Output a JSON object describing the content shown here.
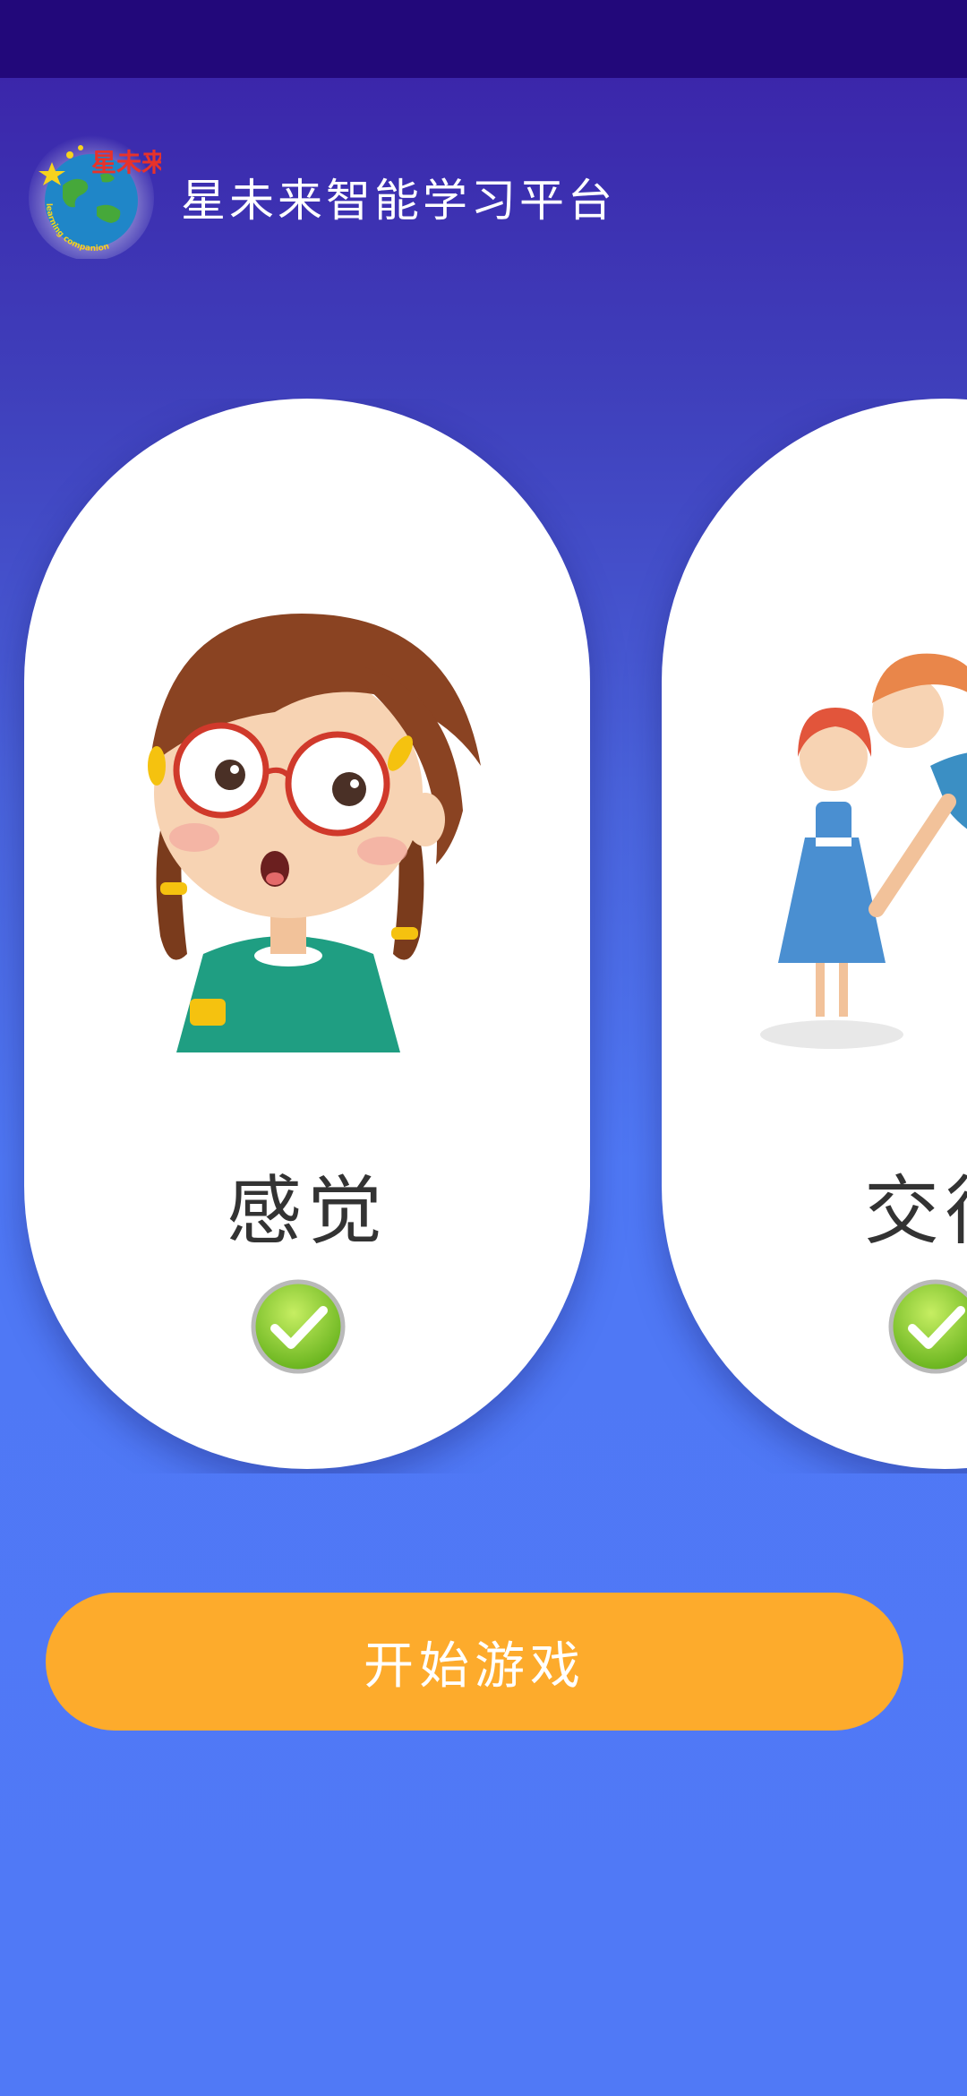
{
  "app": {
    "title": "星未来智能学习平台"
  },
  "logo": {
    "text": "星未来",
    "ring_text": "learning companion",
    "icon": "earth-star-logo"
  },
  "cards": [
    {
      "label": "感觉",
      "illustration": "girl-with-glasses-illustration",
      "status_icon": "check-icon",
      "selected": true
    },
    {
      "label": "交往",
      "illustration": "woman-comforting-girl-illustration",
      "status_icon": "check-icon",
      "selected": true
    }
  ],
  "actions": {
    "start_label": "开始游戏"
  },
  "colors": {
    "status_bar": "#22087a",
    "accent": "#fdab2c",
    "card": "#ffffff",
    "check": "#7cc428"
  }
}
